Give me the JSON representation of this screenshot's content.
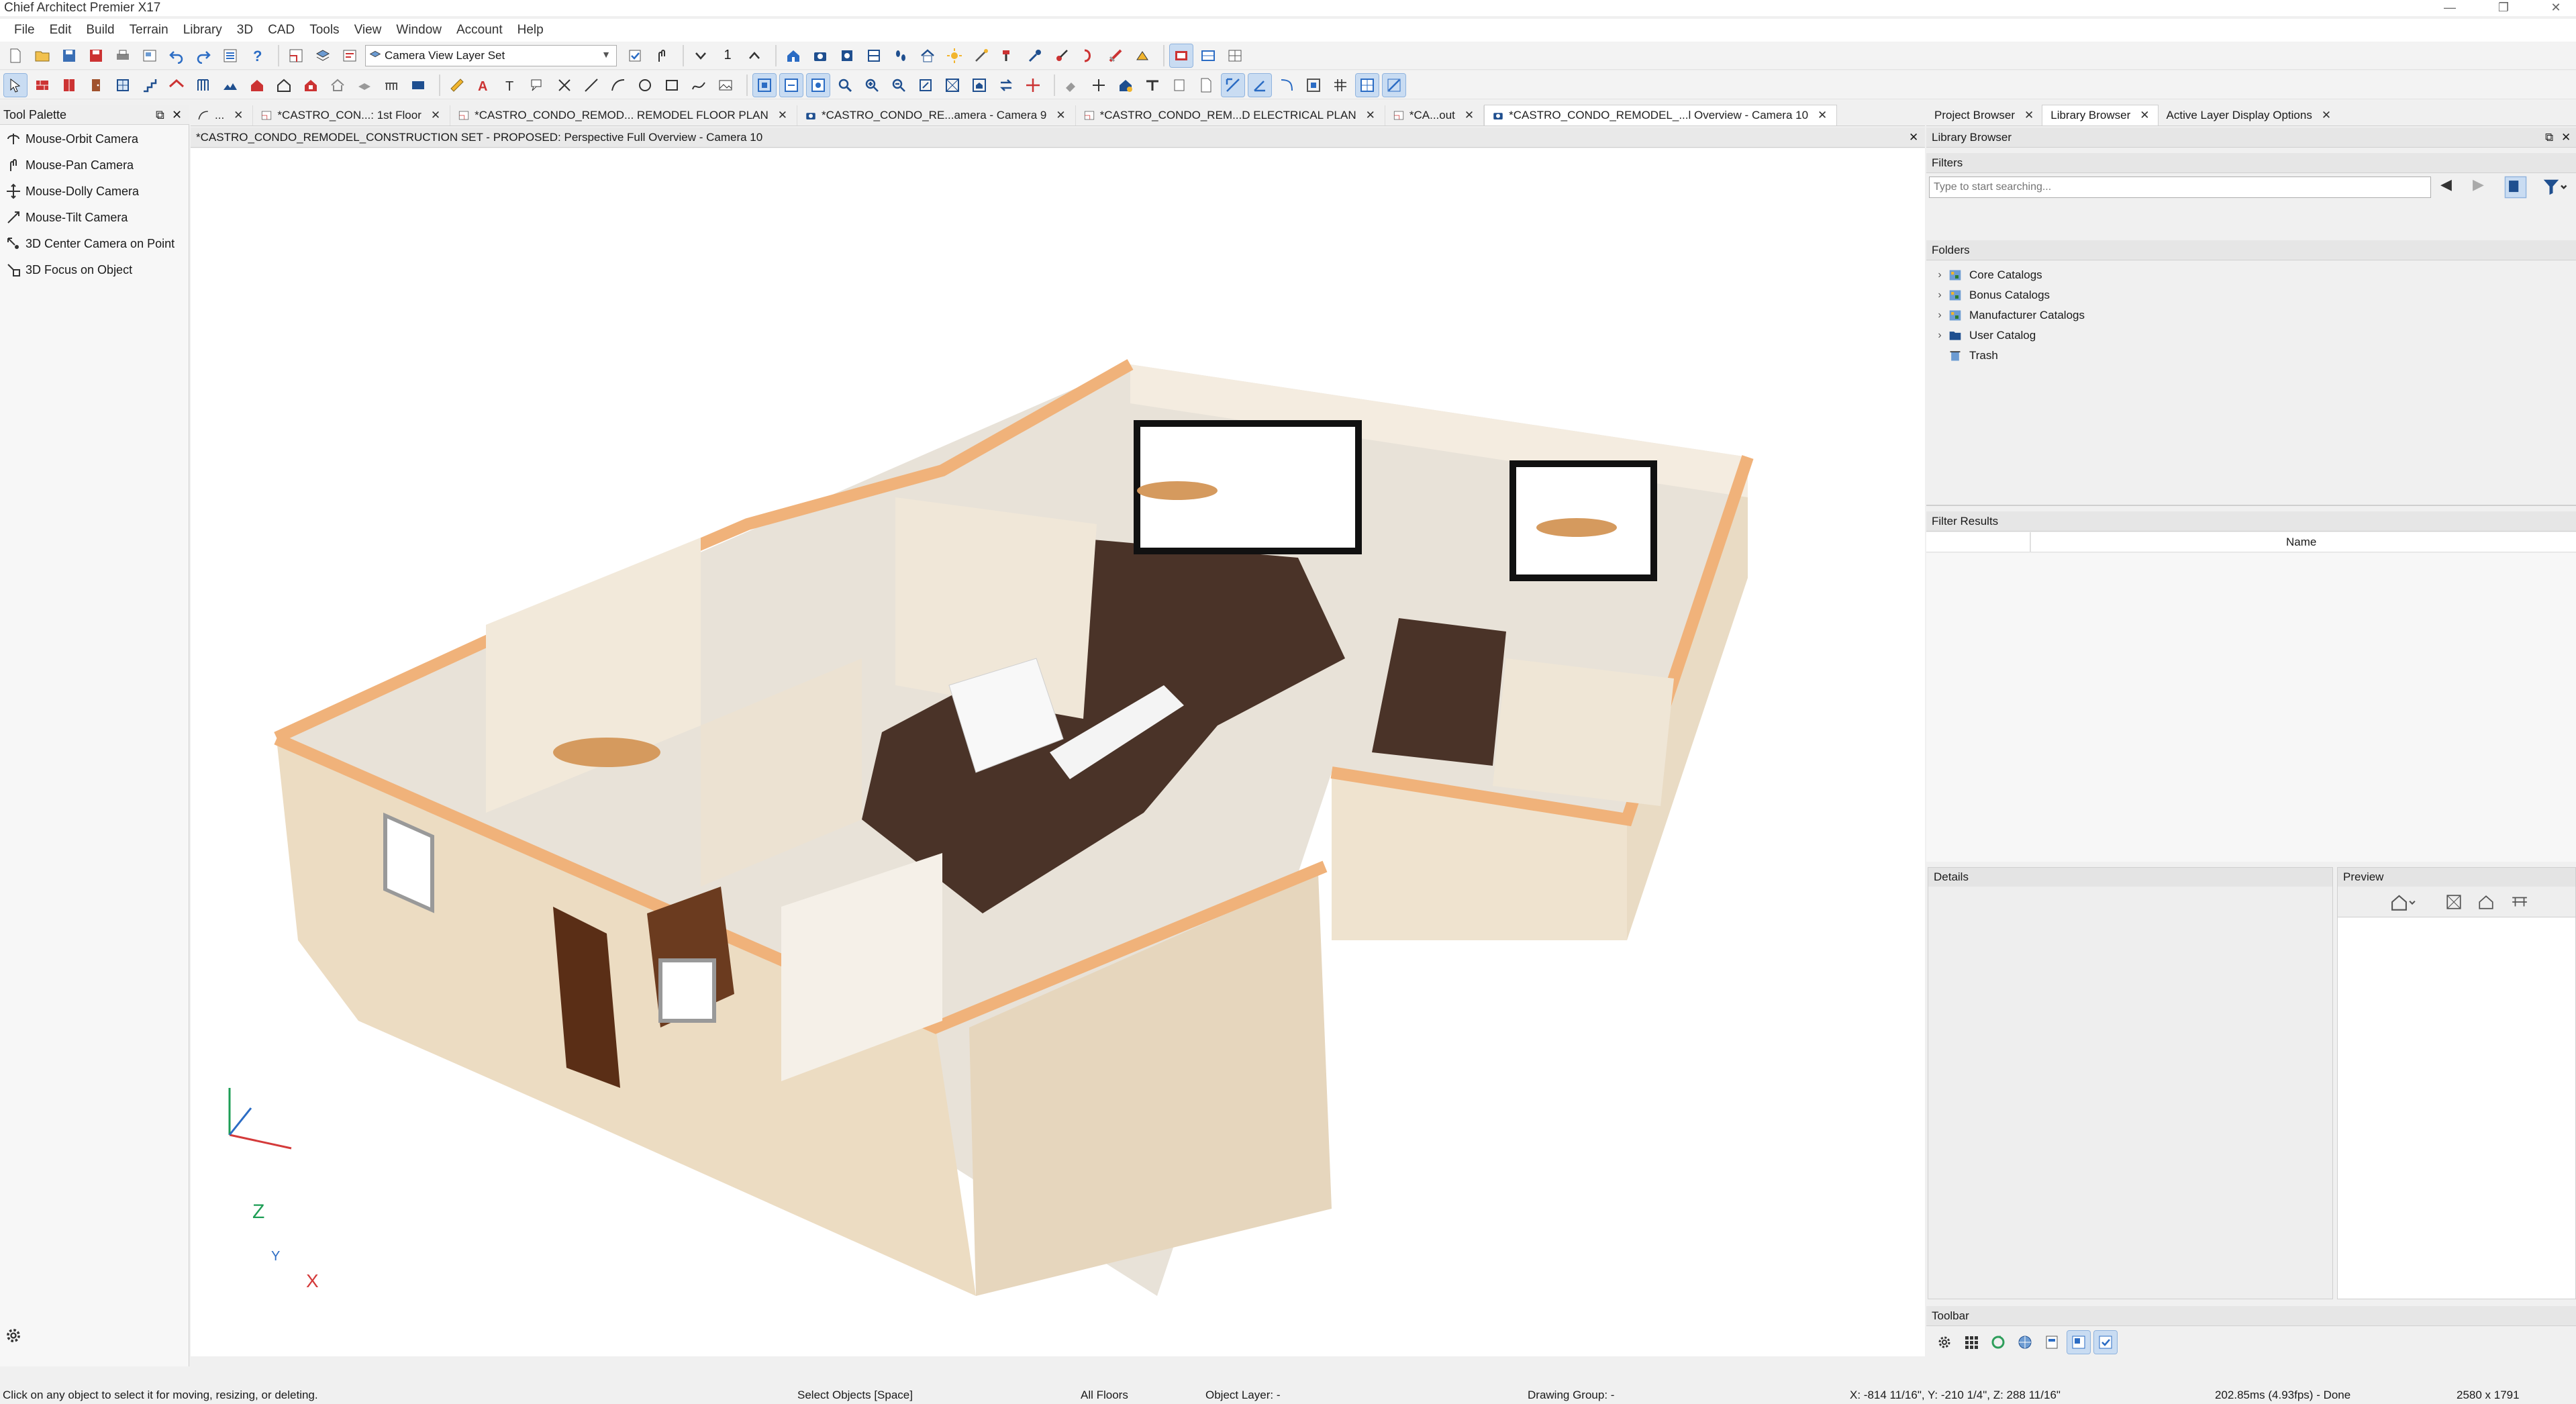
{
  "app": {
    "title": "Chief Architect Premier X17"
  },
  "menu": [
    "File",
    "Edit",
    "Build",
    "Terrain",
    "Library",
    "3D",
    "CAD",
    "Tools",
    "View",
    "Window",
    "Account",
    "Help"
  ],
  "toolbar": {
    "layer_set": "Camera View Layer Set",
    "floor_number": "1"
  },
  "palette": {
    "title": "Tool Palette",
    "items": [
      "Mouse-Orbit Camera",
      "Mouse-Pan Camera",
      "Mouse-Dolly Camera",
      "Mouse-Tilt Camera",
      "3D Center Camera on Point",
      "3D Focus on Object"
    ]
  },
  "doc_tabs": [
    "...",
    "*CASTRO_CON...: 1st Floor",
    "*CASTRO_CONDO_REMOD... REMODEL FLOOR PLAN",
    "*CASTRO_CONDO_RE...amera - Camera 9",
    "*CASTRO_CONDO_REM...D ELECTRICAL PLAN",
    "*CA...out",
    "*CASTRO_CONDO_REMODEL_...l Overview - Camera 10"
  ],
  "view_title": "*CASTRO_CONDO_REMODEL_CONSTRUCTION SET - PROPOSED: Perspective Full Overview - Camera 10",
  "axes": {
    "z": "Z",
    "y": "Y",
    "x": "X"
  },
  "right_tabs": [
    "Project Browser",
    "Library Browser",
    "Active Layer Display Options"
  ],
  "library": {
    "title": "Library Browser",
    "filters_label": "Filters",
    "search_placeholder": "Type to start searching...",
    "folders_label": "Folders",
    "folders": [
      "Core Catalogs",
      "Bonus Catalogs",
      "Manufacturer Catalogs",
      "User Catalog",
      "Trash"
    ],
    "results_label": "Filter Results",
    "name_col": "Name",
    "details_label": "Details",
    "preview_label": "Preview",
    "toolbar_label": "Toolbar"
  },
  "status": {
    "hint": "Click on any object to select it for moving, resizing, or deleting.",
    "mode": "Select Objects [Space]",
    "floors": "All Floors",
    "layer": "Object Layer: -",
    "group": "Drawing Group: -",
    "coords": "X: -814 11/16\", Y: -210 1/4\", Z: 288 11/16\"",
    "timing": "202.85ms (4.93fps) - Done",
    "size": "2580 x 1791"
  },
  "colors": {
    "accent": "#2b6cc4",
    "floor": "#4a3328",
    "wall": "#efe2cc",
    "wall_top": "#f0b27a"
  }
}
